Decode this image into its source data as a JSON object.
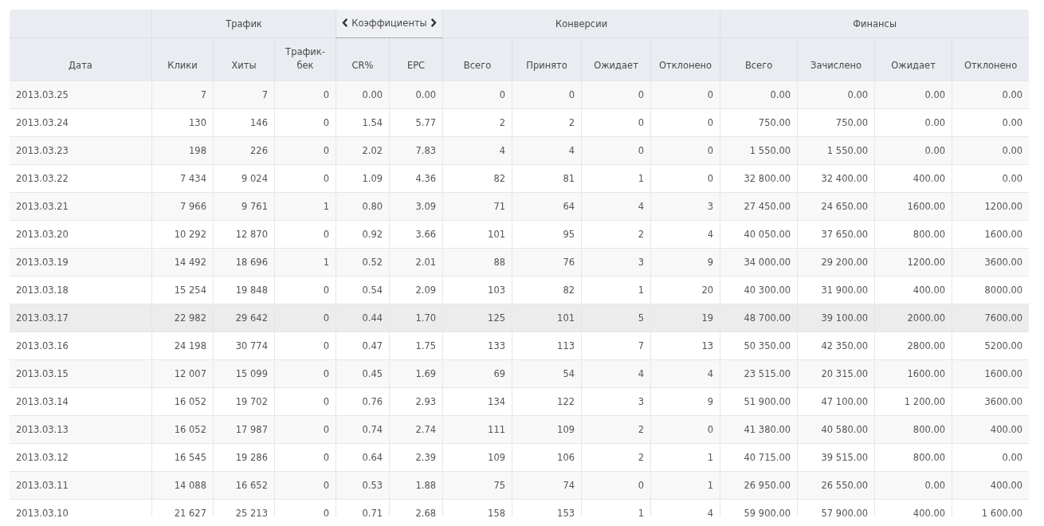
{
  "table": {
    "groups": [
      {
        "kind": "blank"
      },
      {
        "label": "Трафик",
        "kind": "plain"
      },
      {
        "label": "Коэффициенты",
        "kind": "switcher"
      },
      {
        "label": "Конверсии",
        "kind": "plain"
      },
      {
        "label": "Финансы",
        "kind": "plain"
      }
    ],
    "columns": [
      "Дата",
      "Клики",
      "Хиты",
      "Трафик-бек",
      "CR%",
      "EPC",
      "Всего",
      "Принято",
      "Ожидает",
      "Отклонено",
      "Всего",
      "Зачислено",
      "Ожидает",
      "Отклонено"
    ],
    "rows": [
      {
        "selected": false,
        "cells": [
          "2013.03.25",
          "7",
          "7",
          "0",
          "0.00",
          "0.00",
          "0",
          "0",
          "0",
          "0",
          "0.00",
          "0.00",
          "0.00",
          "0.00"
        ]
      },
      {
        "selected": false,
        "cells": [
          "2013.03.24",
          "130",
          "146",
          "0",
          "1.54",
          "5.77",
          "2",
          "2",
          "0",
          "0",
          "750.00",
          "750.00",
          "0.00",
          "0.00"
        ]
      },
      {
        "selected": false,
        "cells": [
          "2013.03.23",
          "198",
          "226",
          "0",
          "2.02",
          "7.83",
          "4",
          "4",
          "0",
          "0",
          "1 550.00",
          "1 550.00",
          "0.00",
          "0.00"
        ]
      },
      {
        "selected": false,
        "cells": [
          "2013.03.22",
          "7 434",
          "9 024",
          "0",
          "1.09",
          "4.36",
          "82",
          "81",
          "1",
          "0",
          "32 800.00",
          "32 400.00",
          "400.00",
          "0.00"
        ]
      },
      {
        "selected": false,
        "cells": [
          "2013.03.21",
          "7 966",
          "9 761",
          "1",
          "0.80",
          "3.09",
          "71",
          "64",
          "4",
          "3",
          "27 450.00",
          "24 650.00",
          "1600.00",
          "1200.00"
        ]
      },
      {
        "selected": false,
        "cells": [
          "2013.03.20",
          "10 292",
          "12 870",
          "0",
          "0.92",
          "3.66",
          "101",
          "95",
          "2",
          "4",
          "40 050.00",
          "37 650.00",
          "800.00",
          "1600.00"
        ]
      },
      {
        "selected": false,
        "cells": [
          "2013.03.19",
          "14 492",
          "18 696",
          "1",
          "0.52",
          "2.01",
          "88",
          "76",
          "3",
          "9",
          "34 000.00",
          "29 200.00",
          "1200.00",
          "3600.00"
        ]
      },
      {
        "selected": false,
        "cells": [
          "2013.03.18",
          "15 254",
          "19 848",
          "0",
          "0.54",
          "2.09",
          "103",
          "82",
          "1",
          "20",
          "40 300.00",
          "31 900.00",
          "400.00",
          "8000.00"
        ]
      },
      {
        "selected": true,
        "cells": [
          "2013.03.17",
          "22 982",
          "29 642",
          "0",
          "0.44",
          "1.70",
          "125",
          "101",
          "5",
          "19",
          "48 700.00",
          "39 100.00",
          "2000.00",
          "7600.00"
        ]
      },
      {
        "selected": false,
        "cells": [
          "2013.03.16",
          "24 198",
          "30 774",
          "0",
          "0.47",
          "1.75",
          "133",
          "113",
          "7",
          "13",
          "50 350.00",
          "42 350.00",
          "2800.00",
          "5200.00"
        ]
      },
      {
        "selected": false,
        "cells": [
          "2013.03.15",
          "12 007",
          "15 099",
          "0",
          "0.45",
          "1.69",
          "69",
          "54",
          "4",
          "4",
          "23 515.00",
          "20 315.00",
          "1600.00",
          "1600.00"
        ]
      },
      {
        "selected": false,
        "cells": [
          "2013.03.14",
          "16 052",
          "19 702",
          "0",
          "0.76",
          "2.93",
          "134",
          "122",
          "3",
          "9",
          "51 900.00",
          "47 100.00",
          "1 200.00",
          "3600.00"
        ]
      },
      {
        "selected": false,
        "cells": [
          "2013.03.13",
          "16 052",
          "17 987",
          "0",
          "0.74",
          "2.74",
          "111",
          "109",
          "2",
          "0",
          "41 380.00",
          "40 580.00",
          "800.00",
          "400.00"
        ]
      },
      {
        "selected": false,
        "cells": [
          "2013.03.12",
          "16 545",
          "19 286",
          "0",
          "0.64",
          "2.39",
          "109",
          "106",
          "2",
          "1",
          "40 715.00",
          "39 515.00",
          "800.00",
          "0.00"
        ]
      },
      {
        "selected": false,
        "cells": [
          "2013.03.11",
          "14 088",
          "16 652",
          "0",
          "0.53",
          "1.88",
          "75",
          "74",
          "0",
          "1",
          "26 950.00",
          "26 550.00",
          "0.00",
          "400.00"
        ]
      },
      {
        "selected": false,
        "cells": [
          "2013.03.10",
          "21 627",
          "25 213",
          "0",
          "0.71",
          "2.68",
          "158",
          "153",
          "1",
          "4",
          "59 900.00",
          "57 900.00",
          "400.00",
          "1 600.00"
        ]
      }
    ]
  }
}
